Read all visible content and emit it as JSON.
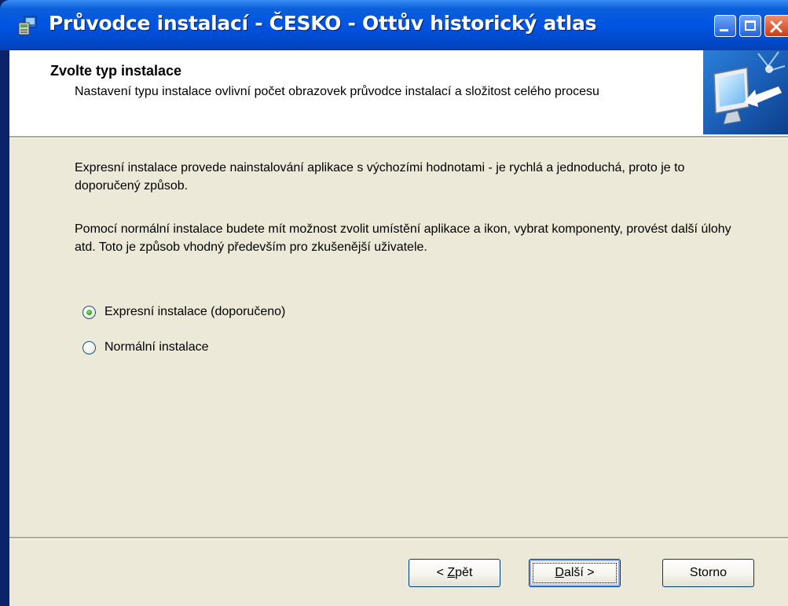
{
  "window": {
    "title": "Průvodce instalací - ČESKO - Ottův historický atlas"
  },
  "header": {
    "title": "Zvolte typ instalace",
    "description": "Nastavení typu instalace ovlivní počet obrazovek průvodce instalací a složitost celého procesu"
  },
  "content": {
    "paragraph_express": "Expresní instalace provede nainstalování aplikace s výchozími hodnotami - je rychlá a jednoduchá, proto je to doporučený způsob.",
    "paragraph_normal": "Pomocí normální instalace budete mít možnost zvolit umístění aplikace a ikon, vybrat komponenty, provést další úlohy atd. Toto je způsob vhodný především pro zkušenější uživatele.",
    "options": [
      {
        "label": "Expresní instalace (doporučeno)",
        "selected": true
      },
      {
        "label": "Normální instalace",
        "selected": false
      }
    ]
  },
  "buttons": {
    "back_prefix": "< ",
    "back_mnemonic": "Z",
    "back_rest": "pět",
    "next_mnemonic": "D",
    "next_rest": "alší >",
    "cancel": "Storno"
  },
  "colors": {
    "titlebar": "#0054e3",
    "dialog_face": "#ece9d8",
    "radio_check": "#36a52b"
  },
  "icons": {
    "app": "installer-icon",
    "header_image": "computer-arrow-icon"
  }
}
